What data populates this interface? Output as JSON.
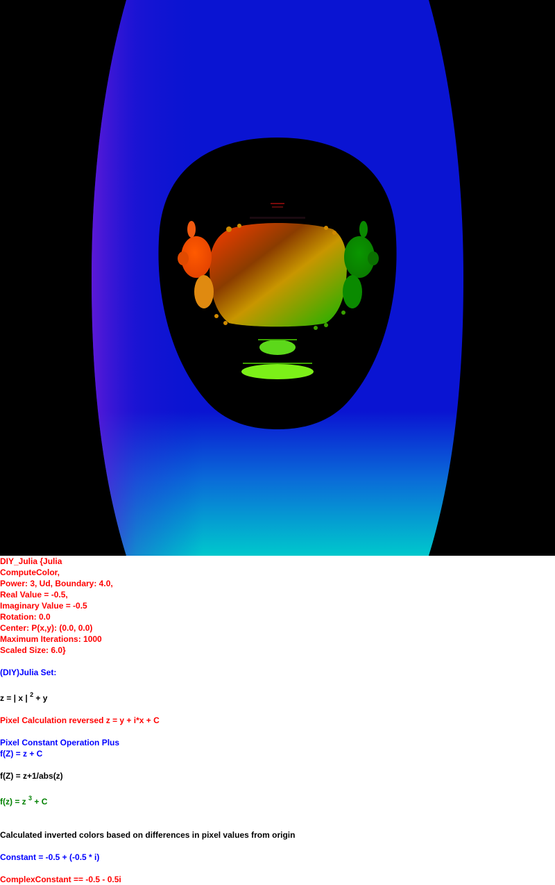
{
  "canvas": {
    "background": "#000000",
    "colors": {
      "outer_blue": "#0a14d2",
      "outer_purple": "#4a14d8",
      "outer_cyan": "#00c8cc",
      "interior": "#000000",
      "set_red": "#ff3c00",
      "set_green": "#14b400",
      "set_lime": "#7cf018"
    }
  },
  "parameters": {
    "lines": [
      "DIY_Julia {Julia",
      "ComputeColor,",
      "Power: 3, Ud, Boundary: 4.0,",
      "Real Value = -0.5,",
      "Imaginary Value = -0.5",
      "Rotation: 0.0",
      "Center: P(x,y): (0.0, 0.0)",
      "Maximum Iterations: 1000",
      "Scaled Size: 6.0}"
    ]
  },
  "formula": {
    "set_title": "(DIY)Julia Set:",
    "z_prefix": "z = | x |",
    "z_exp": "2",
    "z_suffix": " + y",
    "pixel_calc": "Pixel Calculation reversed z = y + i*x + C",
    "pixel_op": "Pixel Constant Operation Plus",
    "f_plus": "f(Z) = z + C",
    "f_abs": "f(Z) = z+1/abs(z)",
    "f_pow_prefix": "f(z) = z",
    "f_pow_exp": "3",
    "f_pow_suffix": " + C",
    "colors_note": "Calculated inverted colors based on differences in pixel values from origin",
    "constant": "Constant = -0.5 + (-0.5 * i)",
    "complex_constant": "ComplexConstant == -0.5 - 0.5i"
  }
}
